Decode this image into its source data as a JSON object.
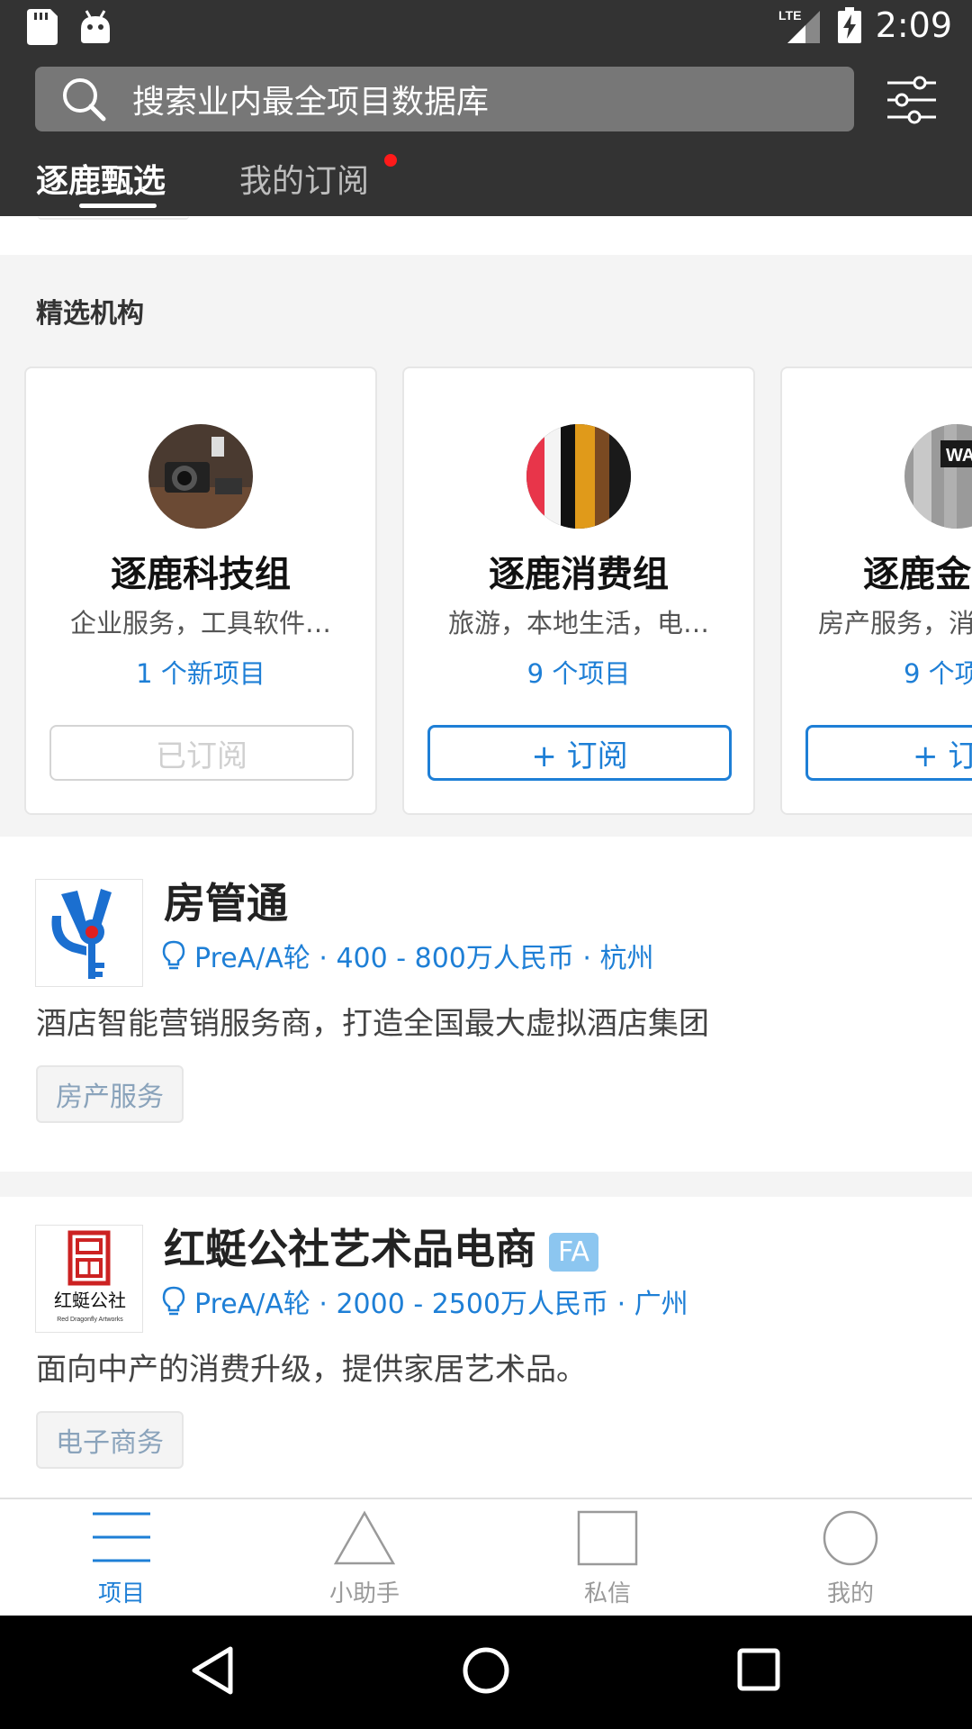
{
  "status_bar": {
    "time": "2:09",
    "network": "LTE"
  },
  "search": {
    "placeholder": "搜索业内最全项目数据库"
  },
  "tabs": [
    {
      "label": "逐鹿甄选",
      "active": true
    },
    {
      "label": "我的订阅",
      "active": false,
      "has_dot": true
    }
  ],
  "featured": {
    "title": "精选机构",
    "orgs": [
      {
        "name": "逐鹿科技组",
        "desc": "企业服务，工具软件…",
        "count": "1 个新项目",
        "button": "已订阅",
        "subscribed": true
      },
      {
        "name": "逐鹿消费组",
        "desc": "旅游，本地生活，电…",
        "count": "9 个项目",
        "button": "+ 订阅",
        "subscribed": false
      },
      {
        "name": "逐鹿金",
        "desc": "房产服务，消",
        "count": "9 个项",
        "button": "+ 订",
        "subscribed": false,
        "avatar_text": "WALL"
      }
    ]
  },
  "projects": [
    {
      "name": "房管通",
      "badge": "",
      "meta": "PreA/A轮 · 400 - 800万人民币 · 杭州",
      "desc": "酒店智能营销服务商，打造全国最大虚拟酒店集团",
      "tag": "房产服务"
    },
    {
      "name": "红蜓公社艺术品电商",
      "badge": "FA",
      "meta": "PreA/A轮 · 2000 - 2500万人民币 · 广州",
      "desc": "面向中产的消费升级，提供家居艺术品。",
      "tag": "电子商务",
      "logo_text": "红蜓公社",
      "logo_subtext": "Red Dragonfly Artworks"
    }
  ],
  "bottom_nav": [
    {
      "label": "项目",
      "icon": "list-icon",
      "active": true
    },
    {
      "label": "小助手",
      "icon": "triangle-icon",
      "active": false
    },
    {
      "label": "私信",
      "icon": "square-icon",
      "active": false
    },
    {
      "label": "我的",
      "icon": "circle-icon",
      "active": false
    }
  ],
  "colors": {
    "header_bg": "#333333",
    "accent": "#1e7fd6",
    "badge": "#8cc6f0",
    "dot": "#ff1a1a"
  }
}
